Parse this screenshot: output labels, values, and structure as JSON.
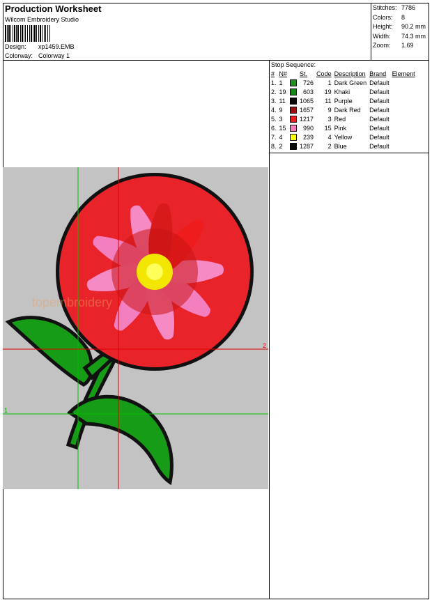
{
  "header": {
    "title": "Production Worksheet",
    "subtitle": "Wilcom Embroidery Studio",
    "design_label": "Design:",
    "design_value": "xp1459.EMB",
    "colorway_label": "Colorway:",
    "colorway_value": "Colorway 1"
  },
  "stats": [
    {
      "label": "Stitches:",
      "value": "7786"
    },
    {
      "label": "Colors:",
      "value": "8"
    },
    {
      "label": "Height:",
      "value": "90.2 mm"
    },
    {
      "label": "Width:",
      "value": "74.3 mm"
    },
    {
      "label": "Zoom:",
      "value": "1.69"
    }
  ],
  "stop_sequence": {
    "title": "Stop Sequence:",
    "headers": [
      "#",
      "N#",
      "St.",
      "Code",
      "Description",
      "Brand",
      "Element"
    ],
    "rows": [
      {
        "idx": "1.",
        "n": "1",
        "color": "#1f8f1f",
        "st": "726",
        "code": "1",
        "desc": "Dark Green",
        "brand": "Default"
      },
      {
        "idx": "2.",
        "n": "19",
        "color": "#138a13",
        "st": "603",
        "code": "19",
        "desc": "Khaki",
        "brand": "Default"
      },
      {
        "idx": "3.",
        "n": "11",
        "color": "#0a0a0a",
        "st": "1065",
        "code": "11",
        "desc": "Purple",
        "brand": "Default"
      },
      {
        "idx": "4.",
        "n": "9",
        "color": "#9b0f0f",
        "st": "1657",
        "code": "9",
        "desc": "Dark Red",
        "brand": "Default"
      },
      {
        "idx": "5.",
        "n": "3",
        "color": "#ee1c1c",
        "st": "1217",
        "code": "3",
        "desc": "Red",
        "brand": "Default"
      },
      {
        "idx": "6.",
        "n": "15",
        "color": "#f47fbf",
        "st": "990",
        "code": "15",
        "desc": "Pink",
        "brand": "Default"
      },
      {
        "idx": "7.",
        "n": "4",
        "color": "#ffff00",
        "st": "239",
        "code": "4",
        "desc": "Yellow",
        "brand": "Default"
      },
      {
        "idx": "8.",
        "n": "2",
        "color": "#0a0a0a",
        "st": "1287",
        "code": "2",
        "desc": "Blue",
        "brand": "Default"
      }
    ]
  },
  "design_preview": {
    "guide_label_1": "1",
    "guide_label_2": "2",
    "watermark": "topembroidery"
  }
}
